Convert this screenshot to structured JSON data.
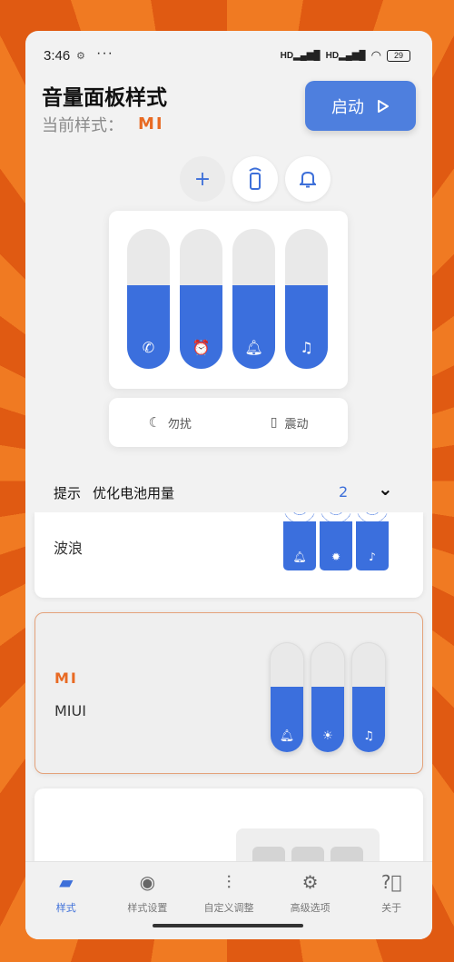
{
  "status_bar": {
    "time": "3:46",
    "signal1": "HD",
    "signal2": "HD",
    "battery": "29"
  },
  "header": {
    "title": "音量面板样式",
    "current_style_label": "当前样式：",
    "current_style_logo": "MI",
    "start_label": "启动"
  },
  "top_icons": [
    "plus-icon",
    "remote-icon",
    "bell-icon"
  ],
  "volume_panel": {
    "sliders": [
      {
        "icon": "phone-icon",
        "level": 0.6
      },
      {
        "icon": "alarm-icon",
        "level": 0.6
      },
      {
        "icon": "bell-icon",
        "level": 0.6
      },
      {
        "icon": "music-icon",
        "level": 0.6
      }
    ]
  },
  "mode_panel": {
    "dnd_label": "勿扰",
    "vibrate_label": "震动"
  },
  "tip": {
    "label": "提示",
    "text": "优化电池用量",
    "count": "2"
  },
  "styles": [
    {
      "name": "波浪"
    },
    {
      "name": "MIUI",
      "logo": "MI"
    },
    {
      "name": ""
    }
  ],
  "bottom_nav": [
    {
      "label": "样式",
      "icon": "card-icon",
      "active": true
    },
    {
      "label": "样式设置",
      "icon": "palette-icon"
    },
    {
      "label": "自定义调整",
      "icon": "sliders-icon"
    },
    {
      "label": "高级选项",
      "icon": "gear-icon"
    },
    {
      "label": "关于",
      "icon": "help-icon"
    }
  ],
  "colors": {
    "accent": "#3b6fdd",
    "brand": "#e86a23"
  }
}
